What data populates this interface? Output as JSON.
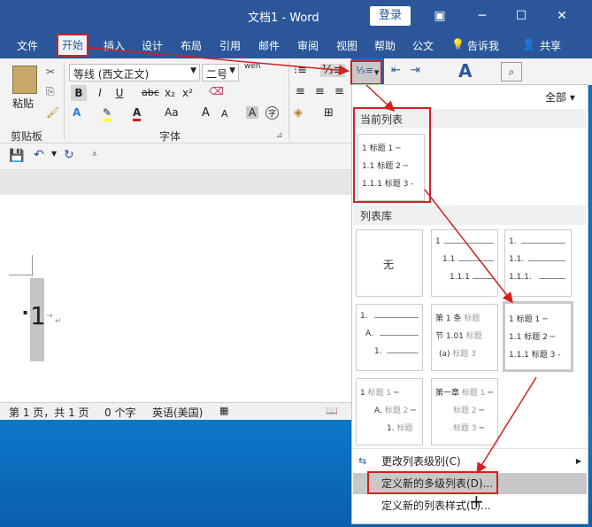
{
  "window": {
    "title": "文档1 - Word",
    "login_label": "登录"
  },
  "tabs": [
    {
      "label": "文件"
    },
    {
      "label": "开始"
    },
    {
      "label": "插入"
    },
    {
      "label": "设计"
    },
    {
      "label": "布局"
    },
    {
      "label": "引用"
    },
    {
      "label": "邮件"
    },
    {
      "label": "审阅"
    },
    {
      "label": "视图"
    },
    {
      "label": "帮助"
    },
    {
      "label": "公文"
    },
    {
      "label": "告诉我"
    },
    {
      "label": "共享"
    }
  ],
  "ribbon": {
    "paste_label": "粘贴",
    "clipboard_label": "剪贴板",
    "font_label": "字体",
    "font_name": "等线 (西文正文)",
    "font_size": "二号",
    "wen_label": "wén",
    "bold": "B",
    "italic": "I",
    "underline": "U",
    "strike": "abc",
    "sub": "x₂",
    "sup": "x²",
    "fontcolor": "A",
    "grow": "A",
    "shrink": "A",
    "aa": "Aa"
  },
  "document": {
    "list_number": "1"
  },
  "status": {
    "page": "第 1 页，共 1 页",
    "words": "0 个字",
    "lang": "英语(美国)"
  },
  "dropdown": {
    "filter": "全部",
    "current_list_header": "当前列表",
    "library_header": "列表库",
    "none_label": "无",
    "current": [
      {
        "n": "1",
        "t": "标题 1"
      },
      {
        "n": "1.1",
        "t": "标题 2"
      },
      {
        "n": "1.1.1",
        "t": "标题 3"
      }
    ],
    "lib_b": [
      "1",
      "1.1",
      "1.1.1"
    ],
    "lib_c": [
      "1.",
      "1.1.",
      "1.1.1."
    ],
    "lib_d": [
      "1.",
      "A.",
      "1."
    ],
    "lib_e": [
      {
        "n": "第 1 条",
        "t": "标题"
      },
      {
        "n": "节 1.01",
        "t": "标题"
      },
      {
        "n": "(a)",
        "t": "标题 3"
      }
    ],
    "lib_f": [
      {
        "n": "1",
        "t": "标题 1"
      },
      {
        "n": "1.1",
        "t": "标题 2"
      },
      {
        "n": "1.1.1",
        "t": "标题 3"
      }
    ],
    "lib_g": [
      {
        "n": "1",
        "t": "标题 1"
      },
      {
        "n": "A.",
        "t": "标题 2"
      },
      {
        "n": "1.",
        "t": "标题"
      }
    ],
    "lib_h": [
      {
        "n": "第一章",
        "t": "标题 1"
      },
      {
        "n": "",
        "t": "标题 2"
      },
      {
        "n": "",
        "t": "标题 3"
      }
    ],
    "menu_change_level": "更改列表级别(C)",
    "menu_define_new": "定义新的多级列表(D)...",
    "menu_define_style": "定义新的列表样式(L)..."
  },
  "colors": {
    "brand": "#2b579a",
    "annotation": "#d32020",
    "highlight": "#ffff00",
    "fontcolor": "#e00000"
  }
}
